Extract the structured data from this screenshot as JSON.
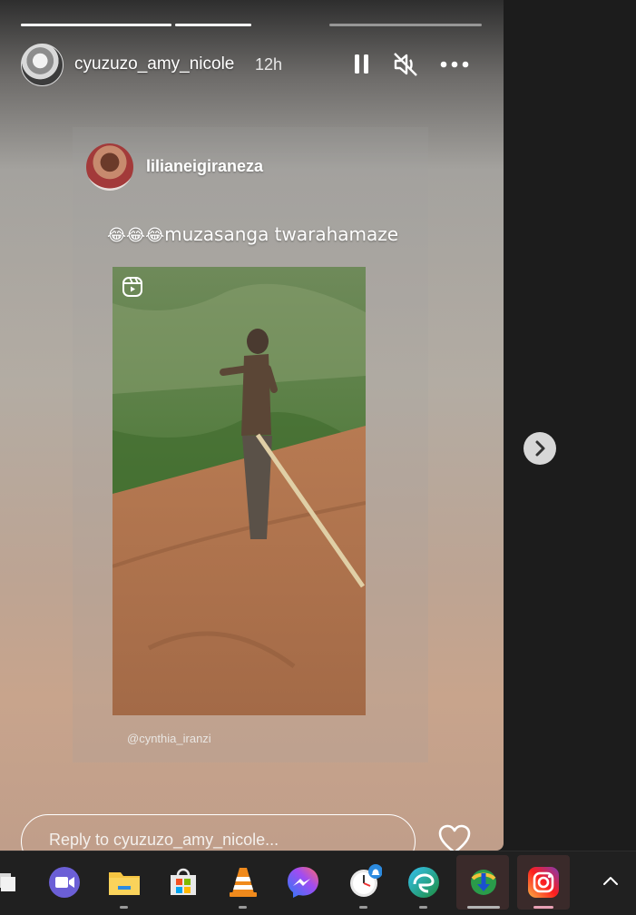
{
  "story": {
    "username": "cyuzuzo_amy_nicole",
    "time": "12h",
    "progress": [
      1,
      1,
      0
    ],
    "shared_post": {
      "username": "lilianeigiraneza",
      "caption_emoji": "😂😂😂",
      "caption_text": "muzasanga twarahamaze",
      "credit": "@cynthia_iranzi"
    },
    "reply_placeholder": "Reply to cyuzuzo_amy_nicole..."
  },
  "controls": {
    "pause_icon": "pause-icon",
    "mute_icon": "volume-muted-icon",
    "more_icon": "more-options-icon",
    "next_icon": "chevron-right-icon",
    "like_icon": "heart-outline-icon"
  },
  "taskbar": {
    "icons": [
      "task-view-icon",
      "zoom-icon",
      "file-explorer-icon",
      "microsoft-store-icon",
      "vlc-icon",
      "messenger-icon",
      "clock-app-icon",
      "edge-icon",
      "installer-icon",
      "instagram-icon"
    ],
    "tray_icon": "chevron-up-icon"
  },
  "colors": {
    "accent_pink": "#e8a0b4",
    "taskbar_bg": "#202020"
  }
}
